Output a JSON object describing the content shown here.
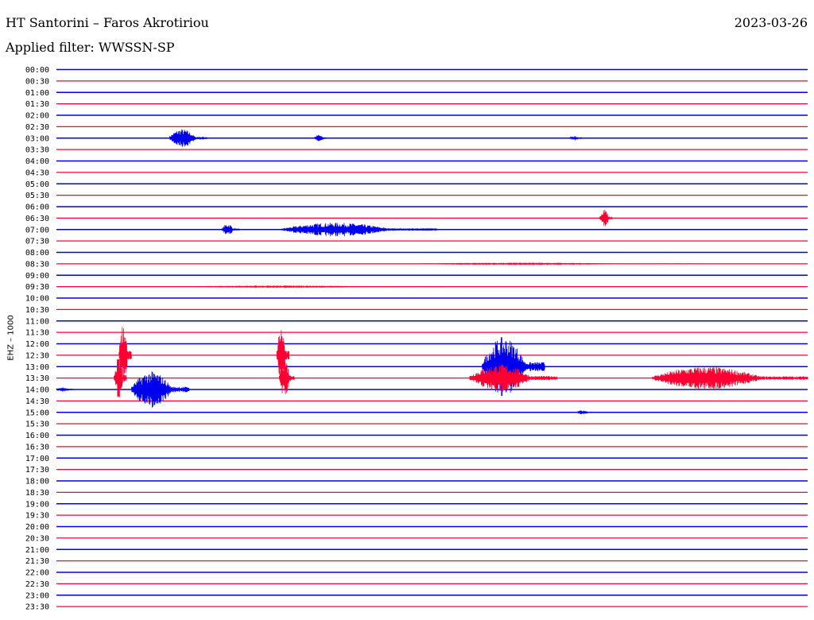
{
  "header": {
    "station": "HT Santorini – Faros Akrotiriou",
    "date": "2023-03-26",
    "filter": "Applied filter: WWSSN-SP"
  },
  "channel_label": "EHZ – 1000",
  "colors": {
    "odd_trace": "#0000ee",
    "even_trace": "#ff0033",
    "text": "#000000"
  },
  "chart_data": {
    "type": "line",
    "title": "",
    "ylabel": "EHZ – 1000",
    "row_labels": [
      "00:00",
      "00:30",
      "01:00",
      "01:30",
      "02:00",
      "02:30",
      "03:00",
      "03:30",
      "04:00",
      "04:30",
      "05:00",
      "05:30",
      "06:00",
      "06:30",
      "07:00",
      "07:30",
      "08:00",
      "08:30",
      "09:00",
      "09:30",
      "10:00",
      "10:30",
      "11:00",
      "11:30",
      "12:00",
      "12:30",
      "13:00",
      "13:30",
      "14:00",
      "14:30",
      "15:00",
      "15:30",
      "16:00",
      "16:30",
      "17:00",
      "17:30",
      "18:00",
      "18:30",
      "19:00",
      "19:30",
      "20:00",
      "20:30",
      "21:00",
      "21:30",
      "22:00",
      "22:30",
      "23:00",
      "23:30"
    ],
    "row_minutes": 30,
    "row_colors": "alternating blue / red",
    "events": [
      {
        "row": "03:00",
        "start_min": 4.5,
        "end_min": 6.0,
        "amp_rows": 0.8
      },
      {
        "row": "03:00",
        "start_min": 10.3,
        "end_min": 10.8,
        "amp_rows": 0.3
      },
      {
        "row": "03:00",
        "start_min": 20.5,
        "end_min": 21.0,
        "amp_rows": 0.2
      },
      {
        "row": "06:30",
        "start_min": 21.7,
        "end_min": 22.2,
        "amp_rows": 0.9
      },
      {
        "row": "07:00",
        "start_min": 6.6,
        "end_min": 7.3,
        "amp_rows": 0.5
      },
      {
        "row": "07:00",
        "start_min": 9.0,
        "end_min": 15.2,
        "amp_rows": 0.6
      },
      {
        "row": "08:30",
        "start_min": 14.5,
        "end_min": 26.0,
        "amp_rows": 0.05
      },
      {
        "row": "09:30",
        "start_min": 5.5,
        "end_min": 15.5,
        "amp_rows": 0.05
      },
      {
        "row": "12:30",
        "start_min": 2.5,
        "end_min": 3.0,
        "amp_rows": 2.7
      },
      {
        "row": "12:30",
        "start_min": 8.8,
        "end_min": 9.3,
        "amp_rows": 2.5
      },
      {
        "row": "13:00",
        "start_min": 17.0,
        "end_min": 19.5,
        "amp_rows": 2.6
      },
      {
        "row": "13:30",
        "start_min": 2.3,
        "end_min": 2.8,
        "amp_rows": 1.8
      },
      {
        "row": "13:30",
        "start_min": 8.9,
        "end_min": 9.5,
        "amp_rows": 1.8
      },
      {
        "row": "13:30",
        "start_min": 16.5,
        "end_min": 20.0,
        "amp_rows": 1.2
      },
      {
        "row": "13:30",
        "start_min": 23.8,
        "end_min": 30.0,
        "amp_rows": 1.0
      },
      {
        "row": "14:00",
        "start_min": 0.0,
        "end_min": 0.7,
        "amp_rows": 0.2
      },
      {
        "row": "14:00",
        "start_min": 3.0,
        "end_min": 5.3,
        "amp_rows": 1.6
      },
      {
        "row": "15:00",
        "start_min": 20.8,
        "end_min": 21.4,
        "amp_rows": 0.2
      }
    ]
  }
}
